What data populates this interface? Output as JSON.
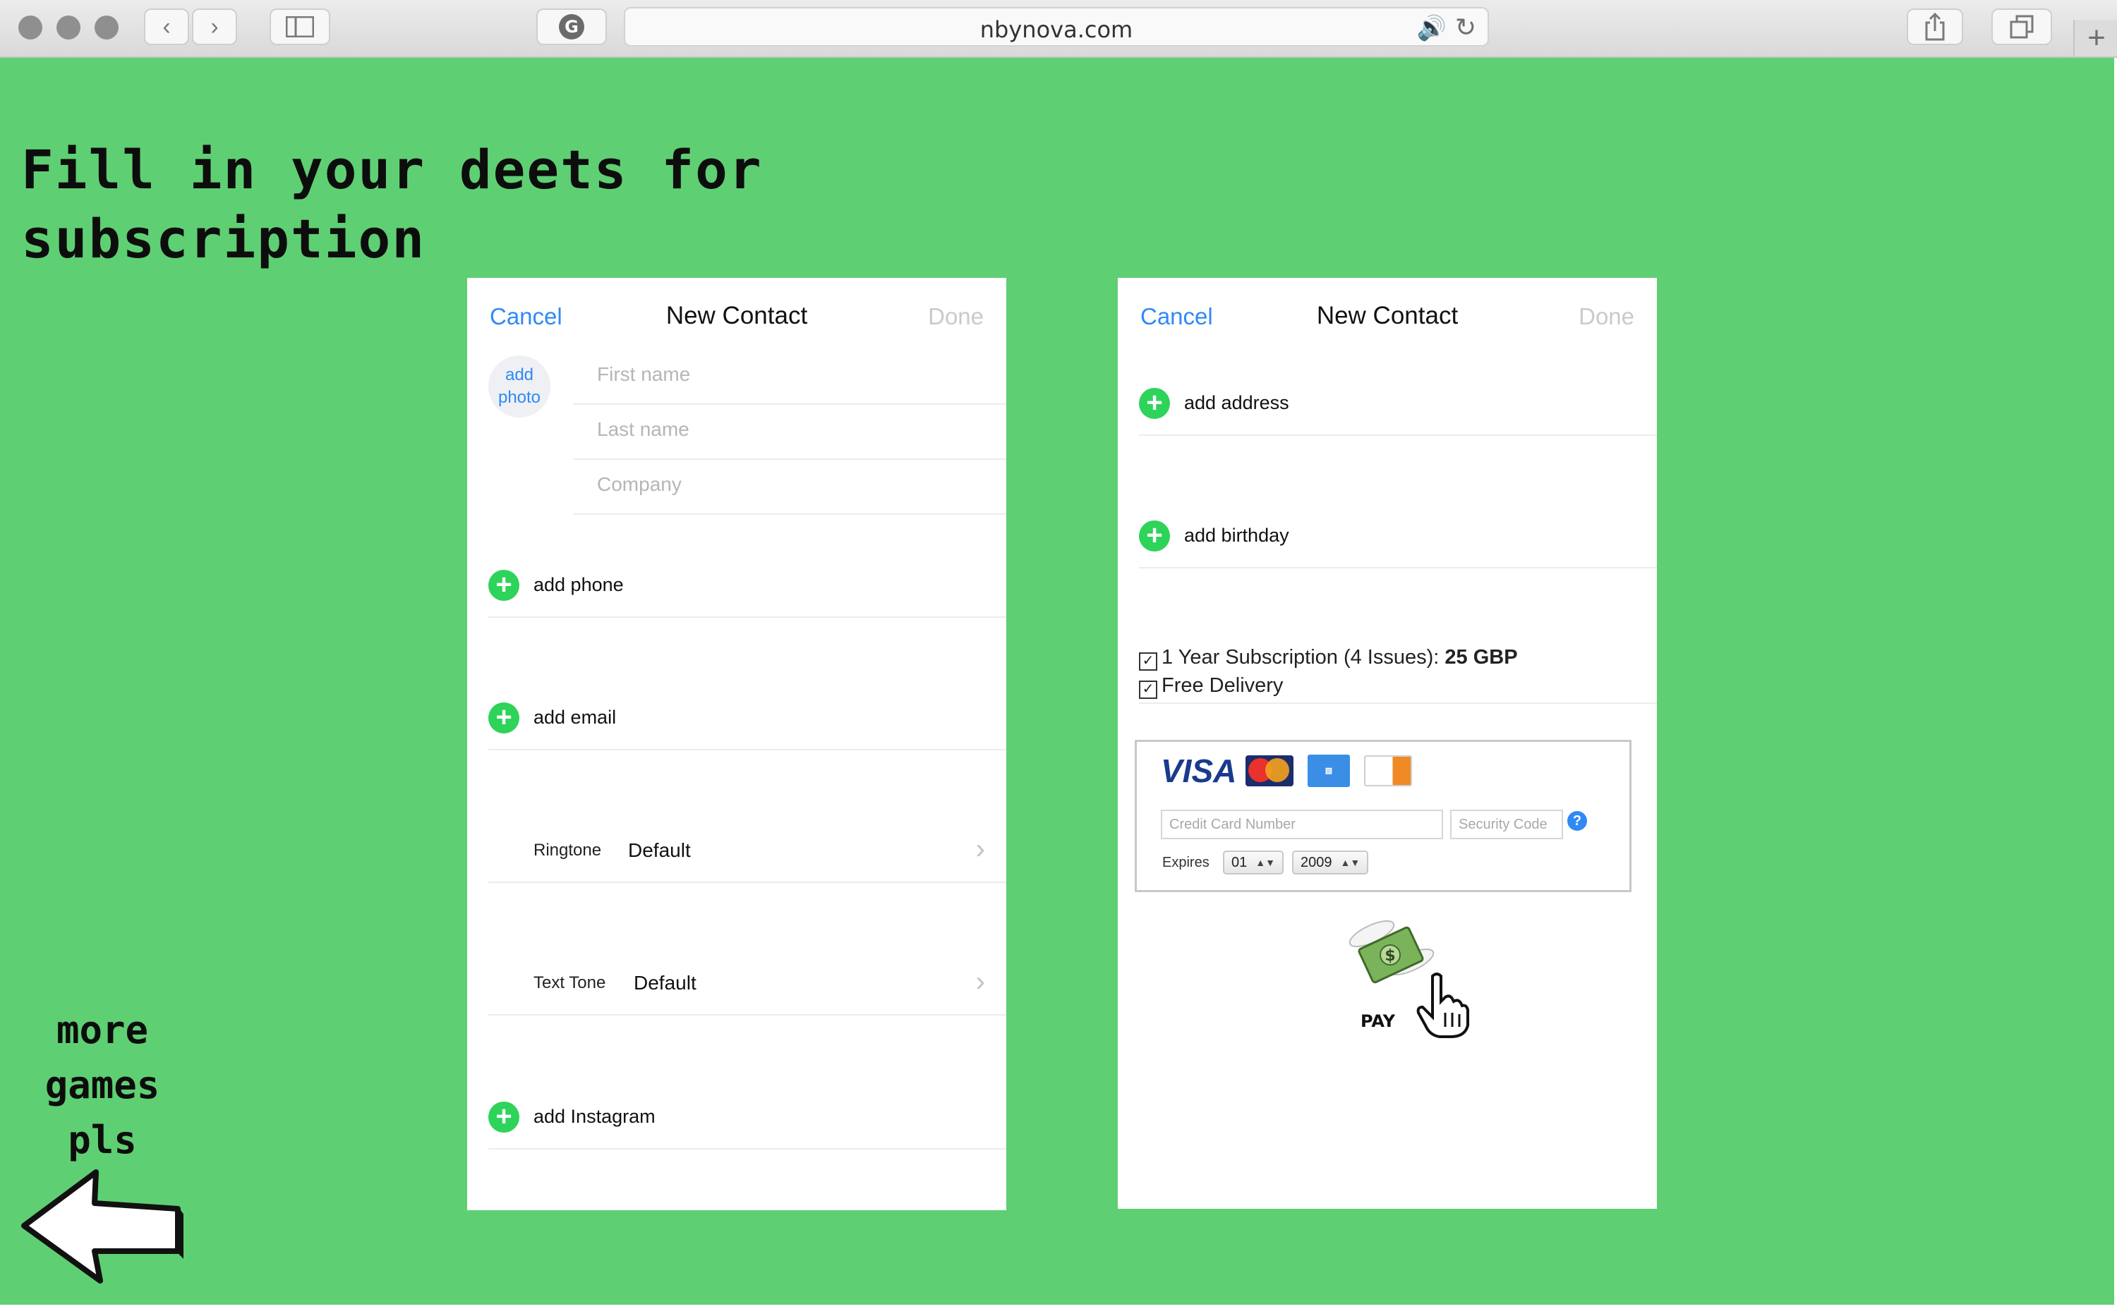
{
  "browser": {
    "url": "nbynova.com",
    "icons": {
      "back": "chevron-left-icon",
      "forward": "chevron-right-icon",
      "sidebar": "sidebar-icon",
      "extension": "grammarly-icon",
      "speaker": "speaker-icon",
      "reload": "reload-icon",
      "share": "share-icon",
      "tabs": "tabs-icon",
      "new_tab": "plus-icon"
    }
  },
  "page": {
    "background": "#5fcf73",
    "headline_line1": "Fill in your deets for",
    "headline_line2": "subscription",
    "more_games_line1": "more",
    "more_games_line2": "games",
    "more_games_line3": "pls"
  },
  "left_panel": {
    "cancel": "Cancel",
    "title": "New Contact",
    "done": "Done",
    "add_photo_line1": "add",
    "add_photo_line2": "photo",
    "first_name_placeholder": "First name",
    "last_name_placeholder": "Last name",
    "company_placeholder": "Company",
    "add_phone": "add phone",
    "add_email": "add email",
    "ringtone_label": "Ringtone",
    "ringtone_value": "Default",
    "text_tone_label": "Text Tone",
    "text_tone_value": "Default",
    "add_instagram": "add Instagram"
  },
  "right_panel": {
    "cancel": "Cancel",
    "title": "New Contact",
    "done": "Done",
    "add_address": "add address",
    "add_birthday": "add birthday",
    "subscription_text": "1 Year Subscription (4 Issues): ",
    "subscription_price": "25 GBP",
    "free_delivery": "Free Delivery",
    "card_brands": {
      "visa": "VISA",
      "mastercard": "MasterCard",
      "amex": "AMERICAN EXPRESS",
      "discover": "DISCOVER"
    },
    "credit_card_placeholder": "Credit Card Number",
    "security_code_placeholder": "Security Code",
    "help": "?",
    "expires_label": "Expires",
    "expiry_month": "01",
    "expiry_year": "2009",
    "pay_label": "PAY"
  },
  "colors": {
    "ios_blue": "#2f8af5",
    "add_green": "#2ed35a",
    "disabled_gray": "#cacaca"
  }
}
